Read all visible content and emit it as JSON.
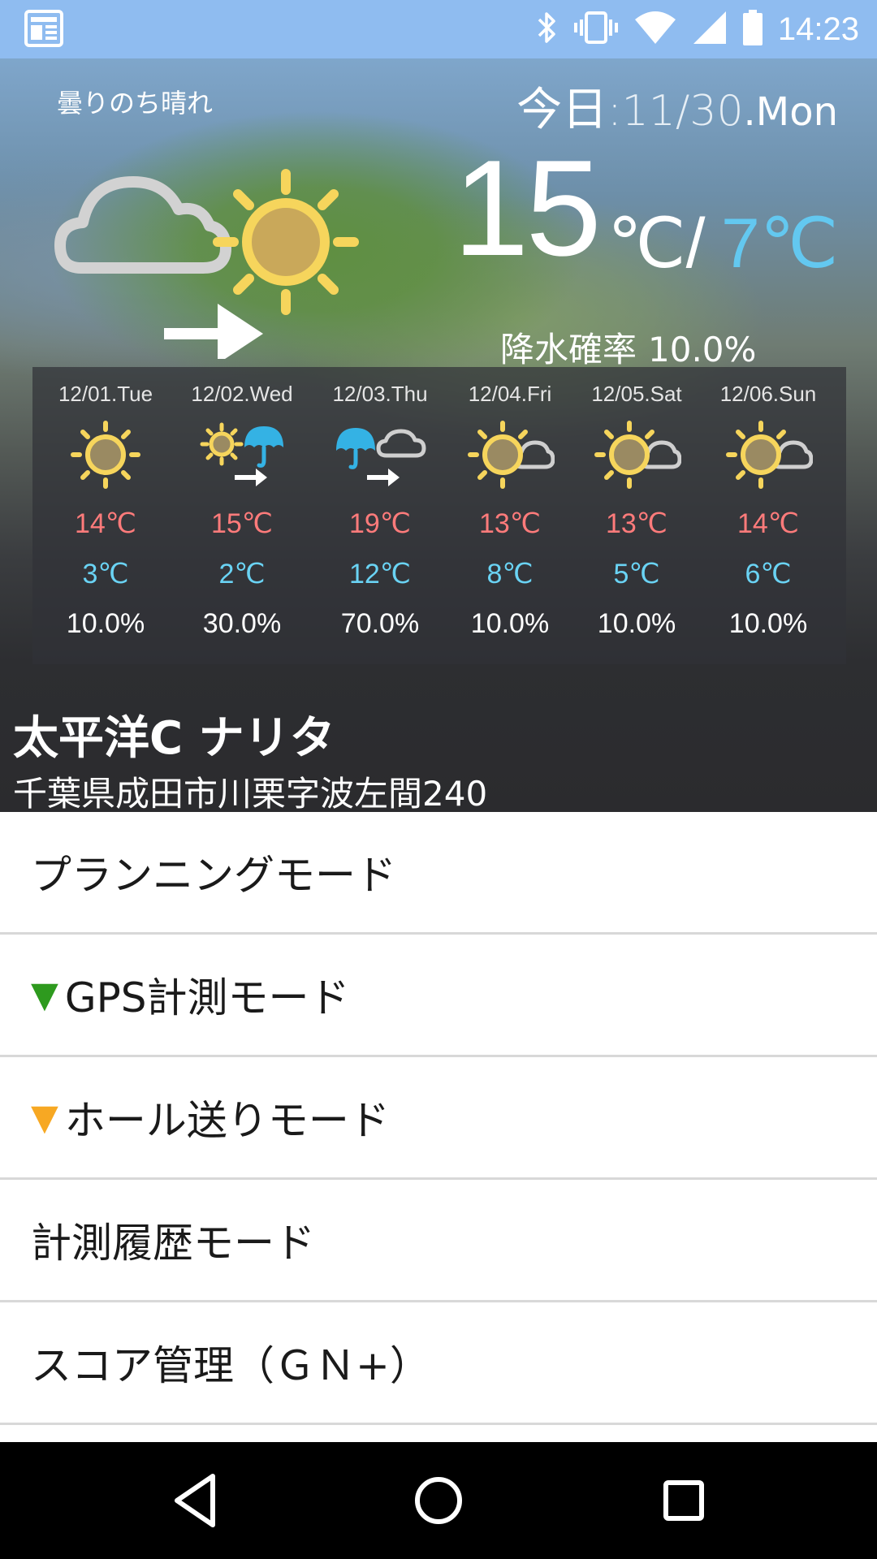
{
  "status_bar": {
    "time": "14:23",
    "icons": [
      "news-icon",
      "bluetooth-icon",
      "vibrate-icon",
      "wifi-icon",
      "signal-icon",
      "battery-icon"
    ]
  },
  "weather": {
    "summary": "曇りのち晴れ",
    "today_label": "今日",
    "today_colon": ":",
    "today_date": "11/30",
    "today_dow": ".Mon",
    "icon": "cloud-then-sun-icon",
    "temp_high": "15",
    "temp_unit": "℃/",
    "temp_low": "7℃",
    "precip_label": "降水確率",
    "precip_value": "10.0%",
    "colors": {
      "high": "#ff7b7b",
      "low": "#6ad3f4"
    },
    "forecast": [
      {
        "date": "12/01.Tue",
        "icon": "sunny-icon",
        "high": "14℃",
        "low": "3℃",
        "precip": "10.0%"
      },
      {
        "date": "12/02.Wed",
        "icon": "sun-then-rain-icon",
        "high": "15℃",
        "low": "2℃",
        "precip": "30.0%"
      },
      {
        "date": "12/03.Thu",
        "icon": "rain-then-cloud-icon",
        "high": "19℃",
        "low": "12℃",
        "precip": "70.0%"
      },
      {
        "date": "12/04.Fri",
        "icon": "sun-and-cloud-icon",
        "high": "13℃",
        "low": "8℃",
        "precip": "10.0%"
      },
      {
        "date": "12/05.Sat",
        "icon": "sun-and-cloud-icon",
        "high": "13℃",
        "low": "5℃",
        "precip": "10.0%"
      },
      {
        "date": "12/06.Sun",
        "icon": "sun-and-cloud-icon",
        "high": "14℃",
        "low": "6℃",
        "precip": "10.0%"
      }
    ]
  },
  "course": {
    "name": "太平洋C ナリタ",
    "address": "千葉県成田市川栗字波左間240"
  },
  "menu": [
    {
      "marker": "",
      "label": "プランニングモード"
    },
    {
      "marker": "▼",
      "label": "GPS計測モード"
    },
    {
      "marker": "▼",
      "label": "ホール送りモード"
    },
    {
      "marker": "",
      "label": "計測履歴モード"
    },
    {
      "marker": "",
      "label": "スコア管理（ＧＮ+）"
    }
  ],
  "nav": {
    "icons": [
      "back-icon",
      "home-icon",
      "recents-icon"
    ]
  }
}
